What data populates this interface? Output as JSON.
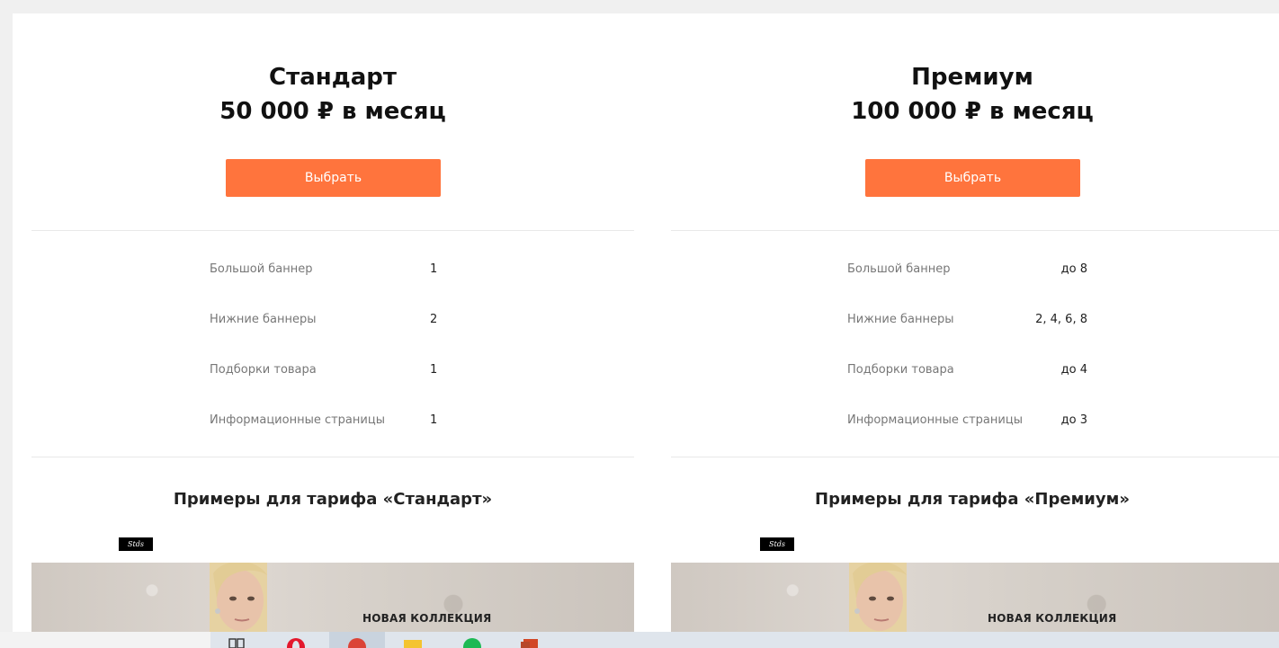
{
  "plans": [
    {
      "name": "Стандарт",
      "price": "50 000 ₽ в месяц",
      "button_label": "Выбрать",
      "features": [
        {
          "label": "Большой баннер",
          "value": "1"
        },
        {
          "label": "Нижние баннеры",
          "value": "2"
        },
        {
          "label": "Подборки товара",
          "value": "1"
        },
        {
          "label": "Информационные страницы",
          "value": "1"
        }
      ],
      "examples_title": "Примеры для тарифа «Стандарт»",
      "example_banner_text": "НОВАЯ КОЛЛЕКЦИЯ"
    },
    {
      "name": "Премиум",
      "price": "100 000 ₽ в месяц",
      "button_label": "Выбрать",
      "features": [
        {
          "label": "Большой баннер",
          "value": "до 8"
        },
        {
          "label": "Нижние баннеры",
          "value": "2, 4, 6, 8"
        },
        {
          "label": "Подборки товара",
          "value": "до 4"
        },
        {
          "label": "Информационные страницы",
          "value": "до 3"
        }
      ],
      "examples_title": "Примеры для тарифа «Премиум»",
      "example_banner_text": "НОВАЯ КОЛЛЕКЦИЯ"
    }
  ],
  "colors": {
    "accent": "#ff743d",
    "muted_text": "#777777",
    "divider": "#e9e9e9"
  },
  "taskbar": {
    "icons": [
      "task-view-icon",
      "opera-icon",
      "chrome-icon",
      "file-explorer-icon",
      "spotify-icon",
      "powerpoint-icon"
    ]
  }
}
